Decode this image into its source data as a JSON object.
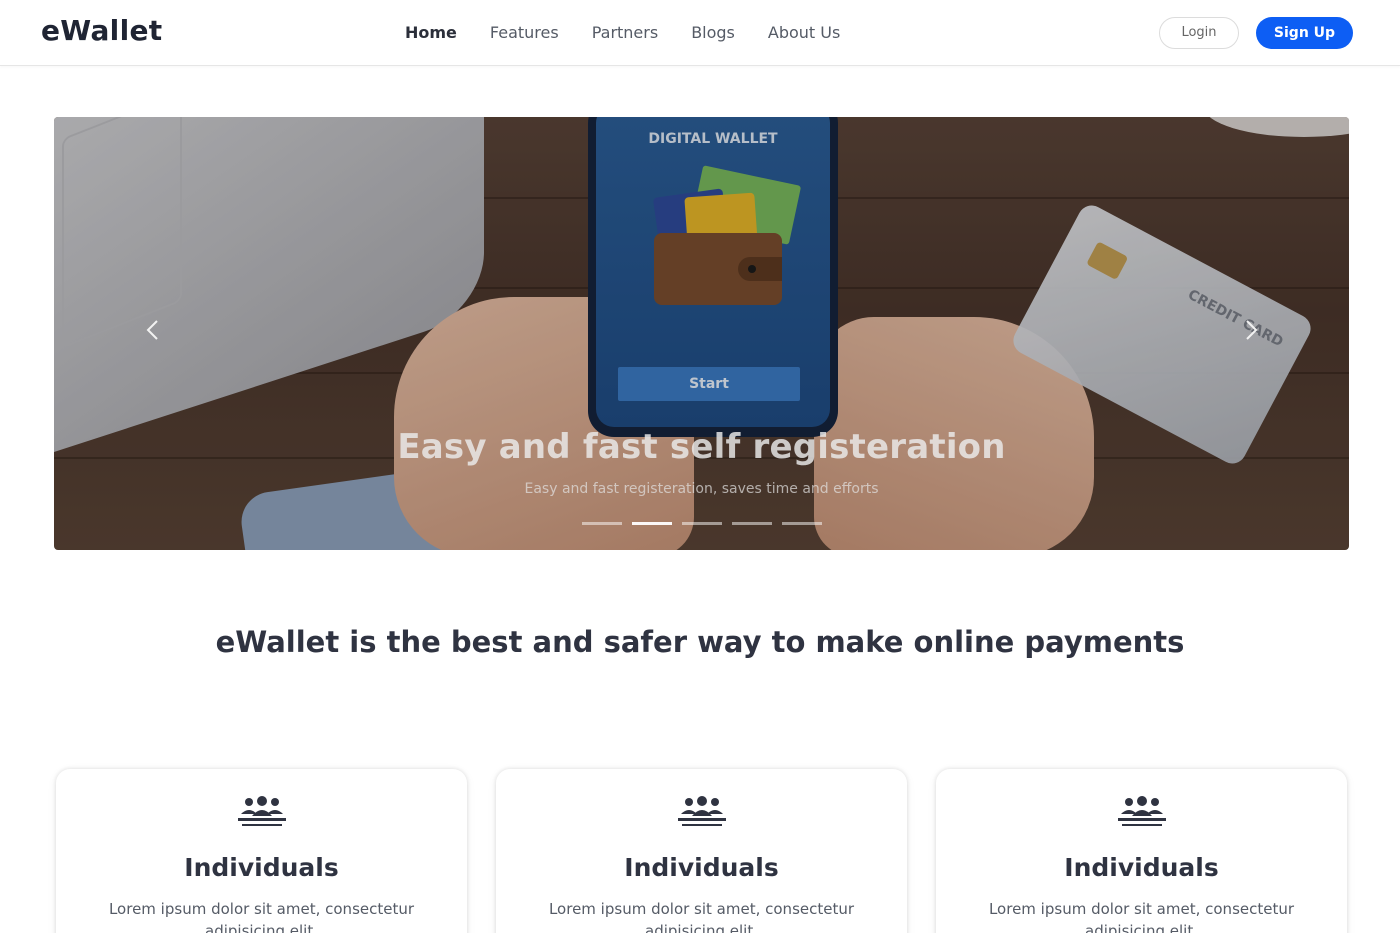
{
  "brand": {
    "name": "eWallet"
  },
  "nav": {
    "items": [
      {
        "label": "Home",
        "active": true
      },
      {
        "label": "Features",
        "active": false
      },
      {
        "label": "Partners",
        "active": false
      },
      {
        "label": "Blogs",
        "active": false
      },
      {
        "label": "About Us",
        "active": false
      }
    ],
    "login_label": "Login",
    "signup_label": "Sign Up"
  },
  "hero": {
    "phone_screen_title": "DIGITAL WALLET",
    "phone_button_label": "Start",
    "credit_card_label": "CREDIT CARD",
    "caption_title": "Easy and fast self registeration",
    "caption_subtitle": "Easy and fast registeration, saves time and efforts",
    "slide_count": 5,
    "active_slide": 2,
    "prev_icon": "chevron-left-icon",
    "next_icon": "chevron-right-icon"
  },
  "tagline": "eWallet is the best and safer way to make online payments",
  "features": [
    {
      "icon": "users-group-icon",
      "title": "Individuals",
      "body": "Lorem ipsum dolor sit amet, consectetur adipisicing elit."
    },
    {
      "icon": "users-group-icon",
      "title": "Individuals",
      "body": "Lorem ipsum dolor sit amet, consectetur adipisicing elit."
    },
    {
      "icon": "users-group-icon",
      "title": "Individuals",
      "body": "Lorem ipsum dolor sit amet, consectetur adipisicing elit."
    }
  ],
  "colors": {
    "accent": "#0d5ef4",
    "text_dark": "#2f3341",
    "text_muted": "#555b66"
  }
}
